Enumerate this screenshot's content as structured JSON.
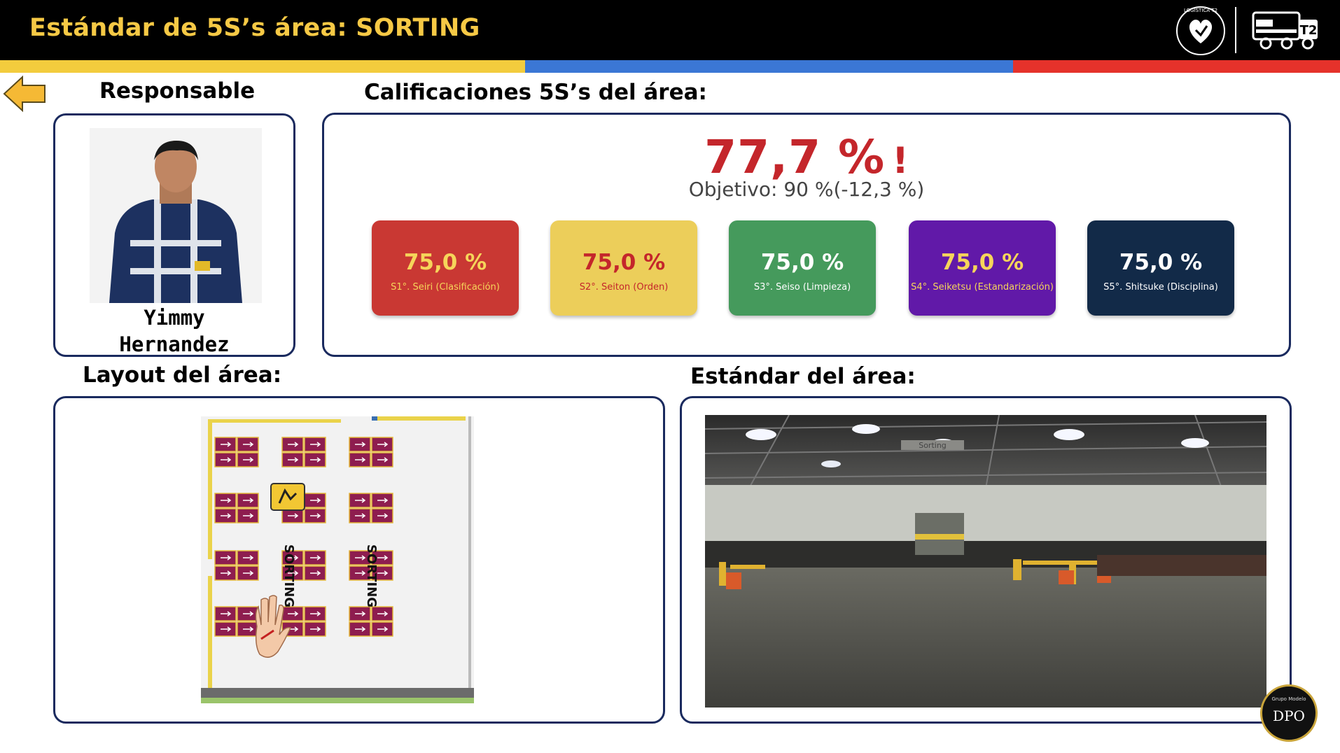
{
  "header": {
    "title": "Estándar de 5S’s área: SORTING",
    "logo_text": "LOGÍSTICA T2",
    "logo_subtext": "CONECTAMOS A TODO CORAZÓN",
    "truck_logo": "T2",
    "stripe_colors": [
      "#f3cc3d",
      "#3b77d5",
      "#e5322b"
    ]
  },
  "nav": {
    "back_icon": "back-arrow-icon"
  },
  "sections": {
    "responsable": "Responsable",
    "calificaciones": "Calificaciones 5S’s del área:",
    "layout": "Layout del área:",
    "estandar": "Estándar del área:"
  },
  "responsable": {
    "first_name": "Yimmy",
    "last_name": "Hernandez"
  },
  "score": {
    "value": "77,7 %",
    "alert": "!",
    "objective": "Objetivo: 90 %",
    "delta": "(-12,3 %)",
    "color": "#c4262b"
  },
  "s_cards": [
    {
      "value": "75,0 %",
      "label": "S1°. Seiri (Clasificación)",
      "bg": "#c93833",
      "fg": "#f6d55a"
    },
    {
      "value": "75,0 %",
      "label": "S2°. Seiton (Orden)",
      "bg": "#ecce5a",
      "fg": "#c4262b"
    },
    {
      "value": "75,0 %",
      "label": "S3°. Seiso (Limpieza)",
      "bg": "#459a5c",
      "fg": "#ffffff"
    },
    {
      "value": "75,0 %",
      "label": "S4°. Seiketsu (Estandarización)",
      "bg": "#6119a8",
      "fg": "#f6d55a"
    },
    {
      "value": "75,0 %",
      "label": "S5°. Shitsuke (Disciplina)",
      "bg": "#122a48",
      "fg": "#ffffff"
    }
  ],
  "layout_map": {
    "labels": [
      "SORTING",
      "SORTING"
    ],
    "rack_color": "#8e1d4f"
  },
  "warehouse_photo": {
    "sign_text": "Sorting"
  },
  "badge": {
    "top": "Grupo Modelo",
    "text": "DPO"
  }
}
